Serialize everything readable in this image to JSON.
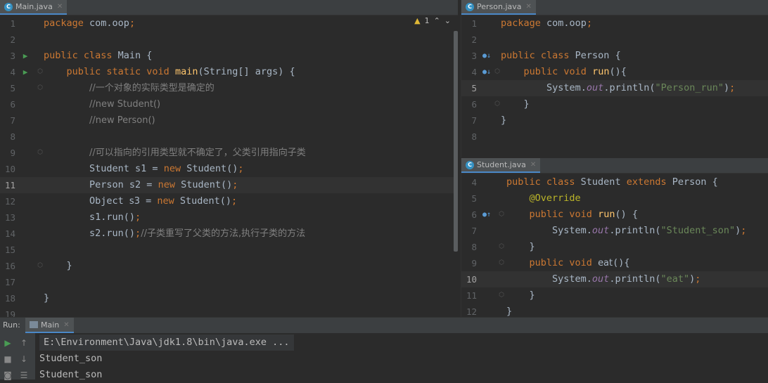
{
  "main_editor": {
    "tab_label": "Main.java",
    "tab_icon": "C",
    "warning_count": "1",
    "lines": [
      {
        "n": "1",
        "tokens": [
          [
            "kw",
            "package "
          ],
          [
            "t",
            "com.oop"
          ],
          [
            "kw",
            ";"
          ]
        ]
      },
      {
        "n": "2",
        "tokens": []
      },
      {
        "n": "3",
        "tokens": [
          [
            "kw",
            "public class "
          ],
          [
            "t",
            "Main {"
          ]
        ]
      },
      {
        "n": "4",
        "tokens": [
          [
            "t",
            "    "
          ],
          [
            "kw",
            "public static void "
          ],
          [
            "fn",
            "main"
          ],
          [
            "t",
            "(String[] args) {"
          ]
        ]
      },
      {
        "n": "5",
        "tokens": [
          [
            "t",
            "        "
          ],
          [
            "cm",
            "//一个对象的实际类型是确定的"
          ]
        ]
      },
      {
        "n": "6",
        "tokens": [
          [
            "t",
            "        "
          ],
          [
            "cm",
            "//new Student()"
          ]
        ]
      },
      {
        "n": "7",
        "tokens": [
          [
            "t",
            "        "
          ],
          [
            "cm",
            "//new Person()"
          ]
        ]
      },
      {
        "n": "8",
        "tokens": []
      },
      {
        "n": "9",
        "tokens": [
          [
            "t",
            "        "
          ],
          [
            "cm",
            "//可以指向的引用类型就不确定了，父类引用指向子类"
          ]
        ]
      },
      {
        "n": "10",
        "tokens": [
          [
            "t",
            "        Student s1 = "
          ],
          [
            "kw",
            "new "
          ],
          [
            "t",
            "Student()"
          ],
          [
            "kw",
            ";"
          ]
        ]
      },
      {
        "n": "11",
        "tokens": [
          [
            "t",
            "        Person s2 = "
          ],
          [
            "kw",
            "new "
          ],
          [
            "t",
            "Student()"
          ],
          [
            "kw",
            ";"
          ]
        ]
      },
      {
        "n": "12",
        "tokens": [
          [
            "t",
            "        Object "
          ],
          [
            "cm2",
            "s3"
          ],
          [
            "t",
            " = "
          ],
          [
            "kw",
            "new "
          ],
          [
            "t",
            "Student()"
          ],
          [
            "kw",
            ";"
          ]
        ]
      },
      {
        "n": "13",
        "tokens": [
          [
            "t",
            "        s1.run()"
          ],
          [
            "kw",
            ";"
          ]
        ]
      },
      {
        "n": "14",
        "tokens": [
          [
            "t",
            "        s2.run()"
          ],
          [
            "kw",
            ";"
          ],
          [
            "cm",
            "//子类重写了父类的方法,执行子类的方法"
          ]
        ]
      },
      {
        "n": "15",
        "tokens": []
      },
      {
        "n": "16",
        "tokens": [
          [
            "t",
            "    }"
          ]
        ]
      },
      {
        "n": "17",
        "tokens": []
      },
      {
        "n": "18",
        "tokens": [
          [
            "t",
            "}"
          ]
        ]
      },
      {
        "n": "19",
        "tokens": []
      }
    ]
  },
  "person_editor": {
    "tab_label": "Person.java",
    "tab_icon": "C",
    "lines": [
      {
        "n": "1",
        "tokens": [
          [
            "kw",
            "package "
          ],
          [
            "t",
            "com.oop"
          ],
          [
            "kw",
            ";"
          ]
        ]
      },
      {
        "n": "2",
        "tokens": []
      },
      {
        "n": "3",
        "tokens": [
          [
            "kw",
            "public class "
          ],
          [
            "t",
            "Person {"
          ]
        ]
      },
      {
        "n": "4",
        "tokens": [
          [
            "t",
            "    "
          ],
          [
            "kw",
            "public void "
          ],
          [
            "fn",
            "run"
          ],
          [
            "t",
            "(){"
          ]
        ]
      },
      {
        "n": "5",
        "tokens": [
          [
            "t",
            "        System."
          ],
          [
            "it",
            "out"
          ],
          [
            "t",
            ".println("
          ],
          [
            "st",
            "\"Person_run\""
          ],
          [
            "t",
            ")"
          ],
          [
            "kw",
            ";"
          ]
        ]
      },
      {
        "n": "6",
        "tokens": [
          [
            "t",
            "    }"
          ]
        ]
      },
      {
        "n": "7",
        "tokens": [
          [
            "t",
            "}"
          ]
        ]
      },
      {
        "n": "8",
        "tokens": []
      }
    ]
  },
  "student_editor": {
    "tab_label": "Student.java",
    "tab_icon": "C",
    "lines": [
      {
        "n": "4",
        "tokens": [
          [
            "kw",
            "public class "
          ],
          [
            "t",
            "Student "
          ],
          [
            "kw",
            "extends "
          ],
          [
            "t",
            "Person {"
          ]
        ]
      },
      {
        "n": "5",
        "tokens": [
          [
            "t",
            "    "
          ],
          [
            "an",
            "@Override"
          ]
        ]
      },
      {
        "n": "6",
        "tokens": [
          [
            "t",
            "    "
          ],
          [
            "kw",
            "public void "
          ],
          [
            "fn",
            "run"
          ],
          [
            "t",
            "() {"
          ]
        ]
      },
      {
        "n": "7",
        "tokens": [
          [
            "t",
            "        System."
          ],
          [
            "it",
            "out"
          ],
          [
            "t",
            ".println("
          ],
          [
            "st",
            "\"Student_son\""
          ],
          [
            "t",
            ")"
          ],
          [
            "kw",
            ";"
          ]
        ]
      },
      {
        "n": "8",
        "tokens": [
          [
            "t",
            "    }"
          ]
        ]
      },
      {
        "n": "9",
        "tokens": [
          [
            "t",
            "    "
          ],
          [
            "kw",
            "public void "
          ],
          [
            "cm2",
            "eat"
          ],
          [
            "t",
            "(){"
          ]
        ]
      },
      {
        "n": "10",
        "tokens": [
          [
            "t",
            "        System."
          ],
          [
            "it",
            "out"
          ],
          [
            "t",
            ".println("
          ],
          [
            "st",
            "\"eat\""
          ],
          [
            "t",
            ")"
          ],
          [
            "kw",
            ";"
          ]
        ]
      },
      {
        "n": "11",
        "tokens": [
          [
            "t",
            "    }"
          ]
        ]
      },
      {
        "n": "12",
        "tokens": [
          [
            "t",
            "}"
          ]
        ]
      }
    ]
  },
  "run_panel": {
    "label": "Run:",
    "tab_label": "Main",
    "output": [
      "E:\\Environment\\Java\\jdk1.8\\bin\\java.exe ...",
      "Student_son",
      "Student_son"
    ]
  }
}
